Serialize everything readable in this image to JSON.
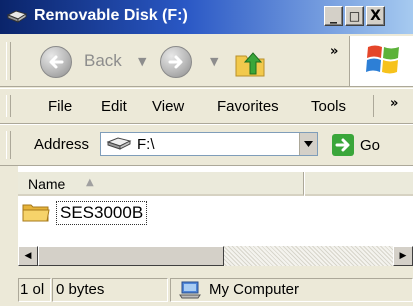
{
  "window": {
    "title": "Removable Disk (F:)",
    "controls": {
      "minimize": "_",
      "maximize": "□",
      "close": "X"
    }
  },
  "toolbar": {
    "back_label": "Back",
    "chevron": "»"
  },
  "menu": {
    "items": [
      "File",
      "Edit",
      "View",
      "Favorites",
      "Tools"
    ],
    "chevron": "»"
  },
  "address": {
    "label": "Address",
    "value": "F:\\",
    "go_label": "Go"
  },
  "list": {
    "column": "Name",
    "items": [
      {
        "name": "SES3000B",
        "type": "folder"
      }
    ]
  },
  "status": {
    "objects": "1 ol",
    "size": "0 bytes",
    "zone": "My Computer"
  },
  "colors": {
    "title_start": "#0a246a",
    "title_end": "#a6caf0",
    "chrome": "#ece9d8",
    "folder": "#f2c94c",
    "go_arrow": "#3aa63a"
  }
}
